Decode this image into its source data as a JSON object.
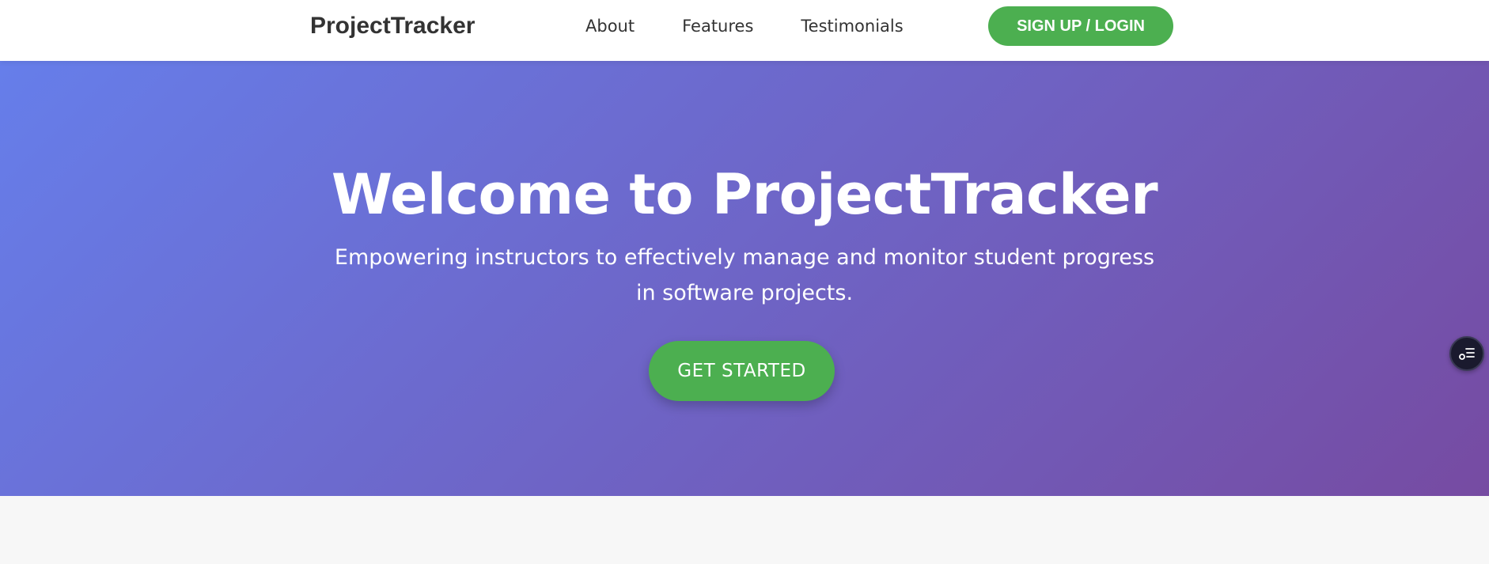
{
  "brand": {
    "name": "ProjectTracker"
  },
  "nav": {
    "links": [
      {
        "label": "About"
      },
      {
        "label": "Features"
      },
      {
        "label": "Testimonials"
      }
    ],
    "signup_label": "SIGN UP / LOGIN"
  },
  "hero": {
    "title": "Welcome to ProjectTracker",
    "subtitle": "Empowering instructors to effectively manage and monitor student progress in software projects.",
    "cta_label": "GET STARTED"
  },
  "floating": {
    "icon": "list-settings-icon"
  },
  "colors": {
    "accent_green": "#4caf50",
    "hero_gradient_start": "#667eea",
    "hero_gradient_end": "#764ba2",
    "brand_text": "#333333"
  }
}
